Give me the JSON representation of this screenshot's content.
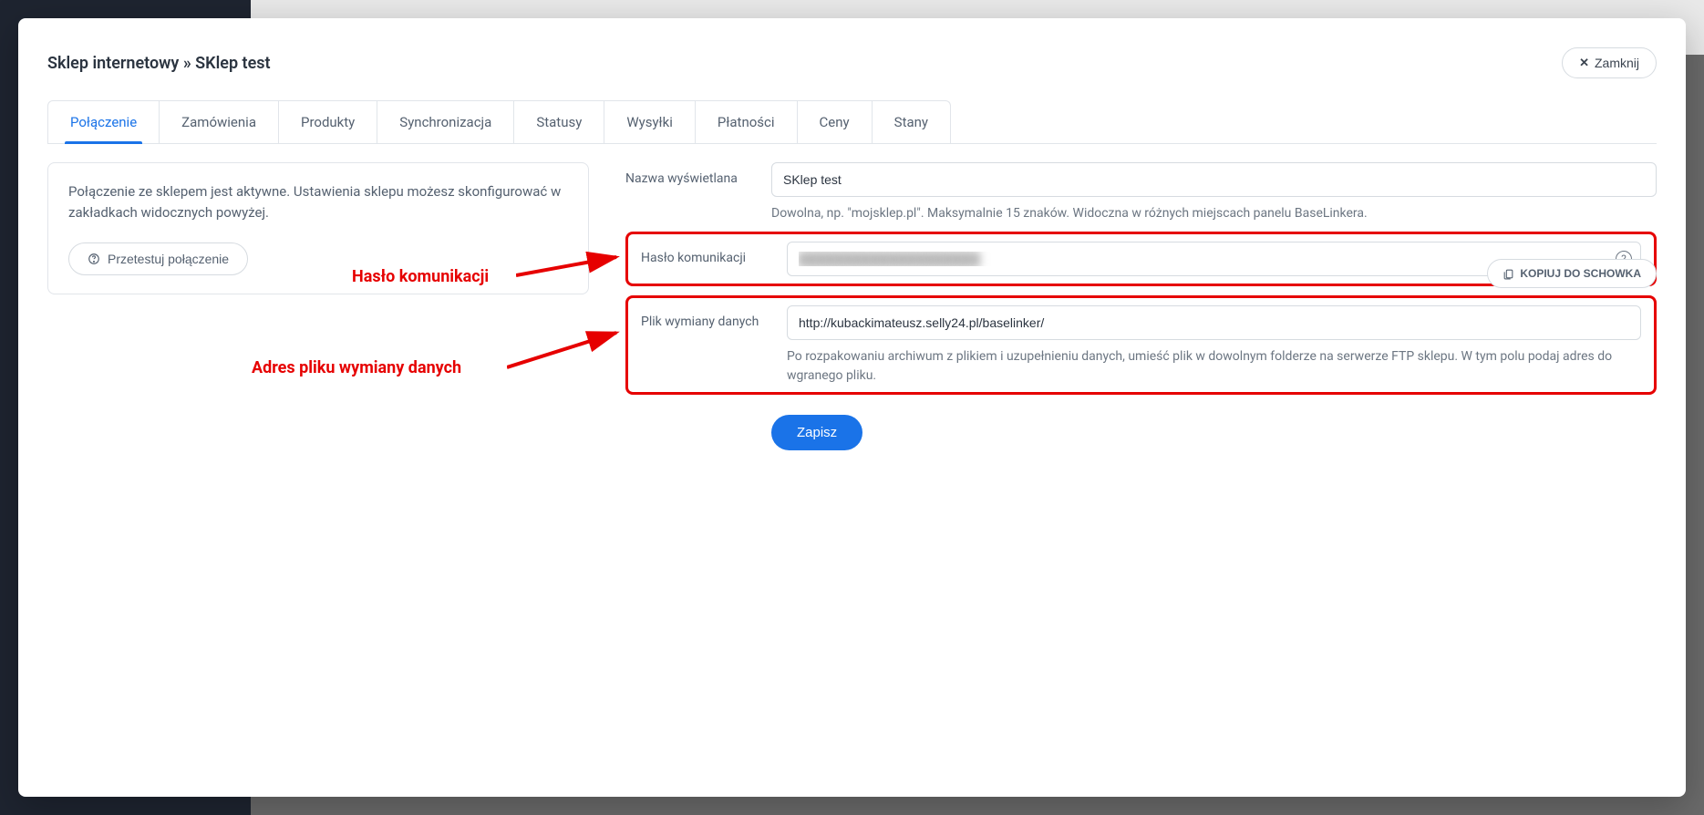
{
  "modal": {
    "title": "Sklep internetowy » SKlep test",
    "close_label": "Zamknij"
  },
  "tabs": [
    {
      "label": "Połączenie",
      "active": true
    },
    {
      "label": "Zamówienia"
    },
    {
      "label": "Produkty"
    },
    {
      "label": "Synchronizacja"
    },
    {
      "label": "Statusy"
    },
    {
      "label": "Wysyłki"
    },
    {
      "label": "Płatności"
    },
    {
      "label": "Ceny"
    },
    {
      "label": "Stany"
    }
  ],
  "left_panel": {
    "info": "Połączenie ze sklepem jest aktywne. Ustawienia sklepu możesz skonfigurować w zakładkach widocznych powyżej.",
    "test_button": "Przetestuj połączenie"
  },
  "form": {
    "display_name": {
      "label": "Nazwa wyświetlana",
      "value": "SKlep test",
      "helper": "Dowolna, np. \"mojsklep.pl\". Maksymalnie 15 znaków. Widoczna w różnych miejscach panelu BaseLinkera."
    },
    "password": {
      "label": "Hasło komunikacji",
      "value": "████████████████████",
      "copy_label": "KOPIUJ DO SCHOWKA"
    },
    "exchange_file": {
      "label": "Plik wymiany danych",
      "value": "http://kubackimateusz.selly24.pl/baselinker/",
      "helper": "Po rozpakowaniu archiwum z plikiem i uzupełnieniu danych, umieść plik w dowolnym folderze na serwerze FTP sklepu. W tym polu podaj adres do wgranego pliku."
    },
    "save_label": "Zapisz"
  },
  "annotations": {
    "password": "Hasło komunikacji",
    "exchange": "Adres pliku wymiany danych"
  },
  "colors": {
    "accent": "#1a73e8",
    "highlight": "#e60000"
  }
}
